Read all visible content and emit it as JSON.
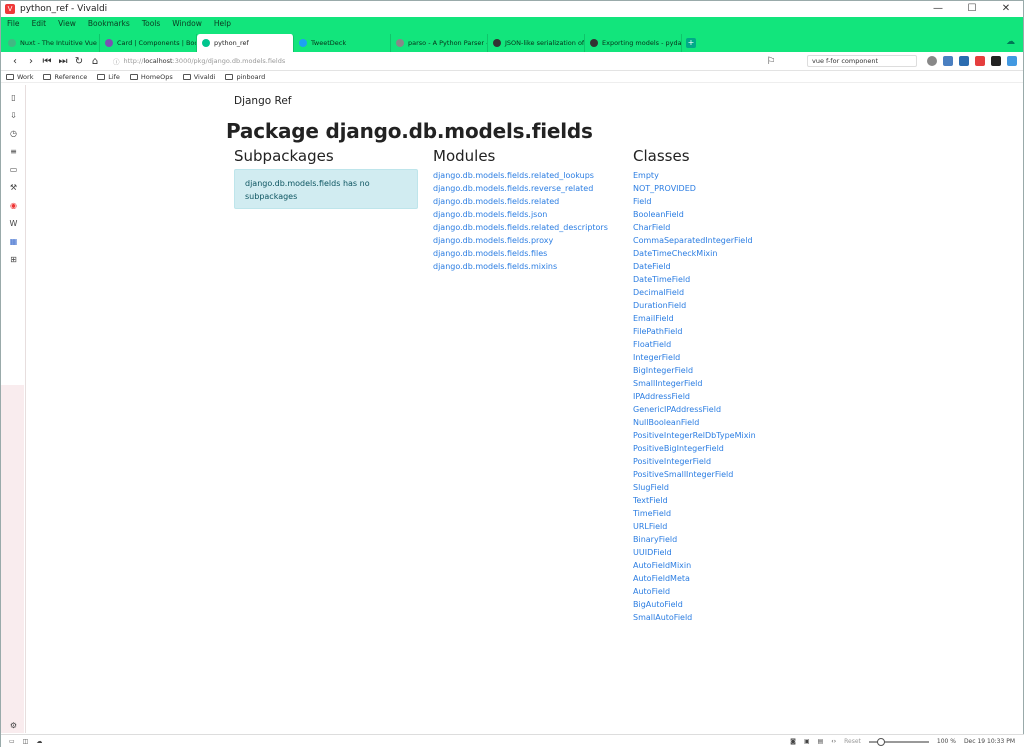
{
  "window": {
    "title": "python_ref - Vivaldi",
    "controls": [
      "—",
      "☐",
      "✕"
    ]
  },
  "menu": [
    "File",
    "Edit",
    "View",
    "Bookmarks",
    "Tools",
    "Window",
    "Help"
  ],
  "tabs": [
    {
      "label": "Nuxt - The Intuitive Vue Fr",
      "color": "#41b883"
    },
    {
      "label": "Card | Components | Boots",
      "color": "#7952b3"
    },
    {
      "label": "python_ref",
      "color": "#00c58e"
    },
    {
      "label": "TweetDeck",
      "color": "#1da1f2"
    },
    {
      "label": "parso - A Python Parser —",
      "color": "#888888"
    },
    {
      "label": "JSON-like serialization of",
      "color": "#333333"
    },
    {
      "label": "Exporting models - pydant",
      "color": "#333333"
    }
  ],
  "address": {
    "scheme": "http://",
    "host": "localhost",
    "path": ":3000/pkg/django.db.models.fields",
    "search": "vue f-for component"
  },
  "bookmarks": [
    "Work",
    "Reference",
    "Life",
    "HomeOps",
    "Vivaldi",
    "pinboard"
  ],
  "status": {
    "reset": "Reset",
    "zoom": "100 %",
    "datetime": "Dec 19  10:33 PM"
  },
  "page": {
    "brand": "Django Ref",
    "title": "Package django.db.models.fields",
    "subpackages": {
      "heading": "Subpackages",
      "empty_message": "django.db.models.fields has no subpackages"
    },
    "modules": {
      "heading": "Modules",
      "items": [
        "django.db.models.fields.related_lookups",
        "django.db.models.fields.reverse_related",
        "django.db.models.fields.related",
        "django.db.models.fields.json",
        "django.db.models.fields.related_descriptors",
        "django.db.models.fields.proxy",
        "django.db.models.fields.files",
        "django.db.models.fields.mixins"
      ]
    },
    "classes": {
      "heading": "Classes",
      "items": [
        "Empty",
        "NOT_PROVIDED",
        "Field",
        "BooleanField",
        "CharField",
        "CommaSeparatedIntegerField",
        "DateTimeCheckMixin",
        "DateField",
        "DateTimeField",
        "DecimalField",
        "DurationField",
        "EmailField",
        "FilePathField",
        "FloatField",
        "IntegerField",
        "BigIntegerField",
        "SmallIntegerField",
        "IPAddressField",
        "GenericIPAddressField",
        "NullBooleanField",
        "PositiveIntegerRelDbTypeMixin",
        "PositiveBigIntegerField",
        "PositiveIntegerField",
        "PositiveSmallIntegerField",
        "SlugField",
        "TextField",
        "TimeField",
        "URLField",
        "BinaryField",
        "UUIDField",
        "AutoFieldMixin",
        "AutoFieldMeta",
        "AutoField",
        "BigAutoField",
        "SmallAutoField"
      ]
    }
  }
}
